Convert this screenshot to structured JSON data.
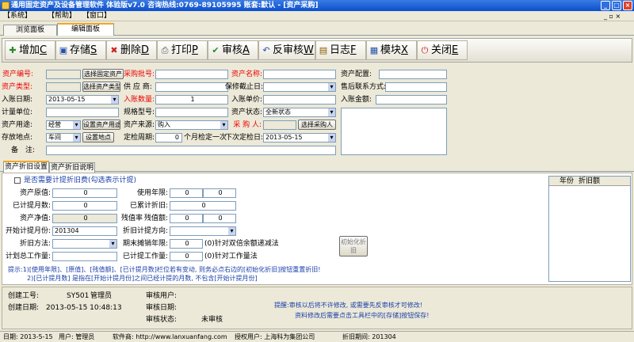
{
  "window": {
    "title": "通用固定资产及设备管理软件 体验版v7.0 咨询热线:0769-89105995 账套:默认 - [资产采购]"
  },
  "menu": [
    "【系统】",
    "【帮助】",
    "【窗口】"
  ],
  "tabs": [
    "浏览面板",
    "编辑面板"
  ],
  "toolbar": [
    {
      "icon": "✚",
      "label": "增加",
      "key": "C"
    },
    {
      "icon": "▣",
      "label": "存储",
      "key": "S"
    },
    {
      "icon": "✖",
      "label": "删除",
      "key": "D"
    },
    {
      "icon": "⎙",
      "label": "打印",
      "key": "P"
    },
    {
      "icon": "✔",
      "label": "审核",
      "key": "A"
    },
    {
      "icon": "↶",
      "label": "反审核",
      "key": "W"
    },
    {
      "icon": "▤",
      "label": "日志",
      "key": "F"
    },
    {
      "icon": "▦",
      "label": "模块",
      "key": "X"
    },
    {
      "icon": "⏻",
      "label": "关闭",
      "key": "E"
    }
  ],
  "form": {
    "asset_no": "资产编号:",
    "asset_type": "资产类型:",
    "entry_date": "入账日期:",
    "entry_date_val": "2013-05-15",
    "unit": "计量单位:",
    "use": "资产用途:",
    "use_val": "经营",
    "location": "存放地点:",
    "location_val": "车间",
    "remark": "备　注:",
    "btn_select_asset": "选择固定资产",
    "btn_select_type": "选择资产类型",
    "btn_set_use": "设置资产用途",
    "btn_set_loc": "设置地点",
    "po_no": "采购批号:",
    "supplier": "供 应 商:",
    "qty": "入账数量:",
    "qty_val": "1",
    "spec": "规格型号:",
    "source": "资产来源:",
    "source_val": "购入",
    "check_cycle": "定检周期:",
    "check_cycle_val": "0",
    "check_cycle_unit": "个月检定一次",
    "asset_name": "资产名称:",
    "warranty": "保修截止日:",
    "unit_price": "入账单价:",
    "status": "资产状态:",
    "status_val": "全新状态",
    "buyer": "采 购 人:",
    "btn_select_buyer": "选择采购人",
    "next_check": "下次定检日:",
    "next_check_val": "2013-05-15",
    "config": "资产配置:",
    "after_sales": "售后联系方式:",
    "amount": "入账金额:"
  },
  "dep_tabs": [
    "资产折旧设置",
    "资产折旧说明"
  ],
  "dep": {
    "need": "是否需要计提折旧费(勾选表示计提)",
    "orig": "资产原值:",
    "orig_val": "0",
    "accum_months": "已计提月数:",
    "accum_months_val": "0",
    "net": "资产净值:",
    "net_val": "0",
    "start_month": "开始计提月份:",
    "start_month_val": "201304",
    "method": "折旧方法:",
    "total_work": "计划总工作量:",
    "life": "使用年限:",
    "life_y": "0",
    "life_m": "0",
    "accum_dep": "已累计折旧:",
    "accum_dep_val": "0",
    "residual": "残值率",
    "residual2": "残值额:",
    "residual_val": "0",
    "residual_val2": "0",
    "direction": "折旧计提方向:",
    "end_amort": "期末摊销年限:",
    "end_amort_val": "0",
    "end_amort_note": "(0)针对双倍余额递减法",
    "done_work": "已计提工作量:",
    "done_work_val": "0",
    "done_work_note": "(0)针对工作量法",
    "btn_init": "初始化折旧",
    "col_year": "年份",
    "col_dep": "折旧额",
    "hint1": "提示:1)[使用年限]、[原值]、[残值额]、[已计提月数]栏位若有变动, 则务必点右边的[初始化折旧]按钮重置折旧!",
    "hint2": "2)[已计提月数] 是指在[开始计提月份]之间已经计提的月数, 不包含[开始计提月份]"
  },
  "footer": {
    "creator_no": "创建工号:",
    "creator_no_val": "SY501",
    "creator_name": "管理员",
    "create_date": "创建日期:",
    "create_date_val": "2013-05-15 10:48:13",
    "audit_user": "审核用户:",
    "audit_date": "审核日期:",
    "audit_status": "审核状态:",
    "audit_status_val": "未审核",
    "note1": "提醒:审核以后将不许修改, 或需要先反审核才可修改!",
    "note2": "资料修改后需要点击工具栏中的[存储]按钮保存!"
  },
  "status": [
    "日期: 2013-5-15",
    "用户: 管理员",
    "软件商: http://www.lanxuanfang.com",
    "授权用户: 上海科为集团公司",
    "折旧期间: 201304"
  ],
  "colors": {
    "title": "#0a4fcf",
    "red_label": "#e00000",
    "accent": "#f5a623"
  }
}
